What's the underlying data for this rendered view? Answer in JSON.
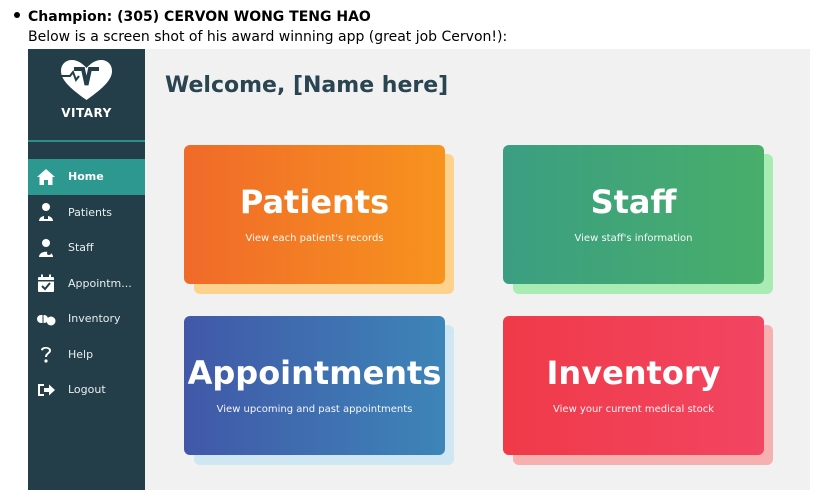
{
  "document": {
    "heading": "Champion: (305) CERVON WONG TENG HAO",
    "caption": "Below is a screen shot of his award winning app (great job Cervon!):"
  },
  "app": {
    "brand": "VITARY",
    "welcome": "Welcome, [Name here]",
    "nav": [
      {
        "label": "Home",
        "icon": "home-icon",
        "active": true
      },
      {
        "label": "Patients",
        "icon": "patient-icon",
        "active": false
      },
      {
        "label": "Staff",
        "icon": "staff-icon",
        "active": false
      },
      {
        "label": "Appointm...",
        "icon": "calendar-icon",
        "active": false
      },
      {
        "label": "Inventory",
        "icon": "pills-icon",
        "active": false
      },
      {
        "label": "Help",
        "icon": "question-icon",
        "active": false
      },
      {
        "label": "Logout",
        "icon": "logout-icon",
        "active": false
      }
    ],
    "cards": [
      {
        "title": "Patients",
        "subtitle": "View each patient's records",
        "color": "#f27a26"
      },
      {
        "title": "Staff",
        "subtitle": "View staff's information",
        "color": "#3fa57a"
      },
      {
        "title": "Appointments",
        "subtitle": "View upcoming and past appointments",
        "color": "#3d6aae"
      },
      {
        "title": "Inventory",
        "subtitle": "View your current medical stock",
        "color": "#f04457"
      }
    ]
  }
}
